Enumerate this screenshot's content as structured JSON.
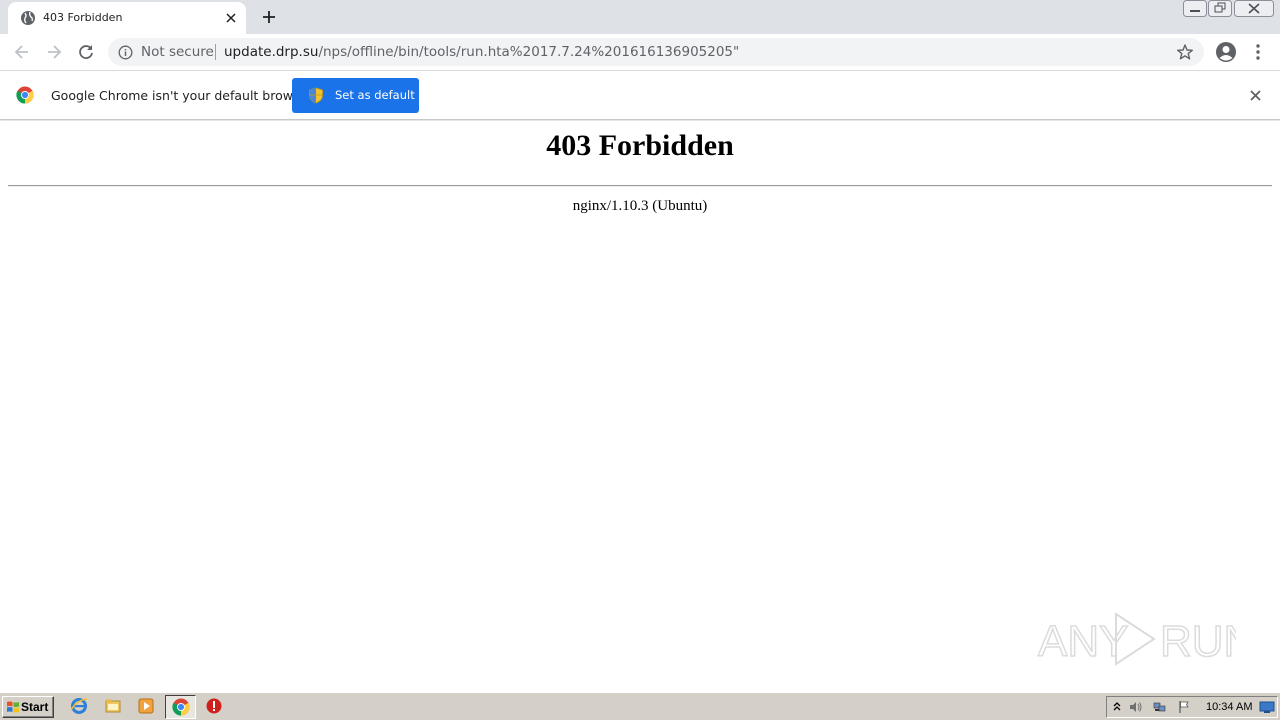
{
  "browser": {
    "tab": {
      "title": "403 Forbidden"
    },
    "omnibox": {
      "security_label": "Not secure",
      "url_host": "update.drp.su",
      "url_path": "/nps/offline/bin/tools/run.hta%2017.7.24%201616136905205\""
    },
    "infobar": {
      "message": "Google Chrome isn't your default browser",
      "button_label": "Set as default"
    }
  },
  "page": {
    "heading": "403 Forbidden",
    "server": "nginx/1.10.3 (Ubuntu)"
  },
  "watermark": {
    "text": "ANY RUN"
  },
  "taskbar": {
    "start_label": "Start",
    "clock": "10:34 AM"
  },
  "colors": {
    "accent": "#1a73e8",
    "tabstrip": "#dee1e6",
    "taskbar": "#d4d0c8"
  }
}
